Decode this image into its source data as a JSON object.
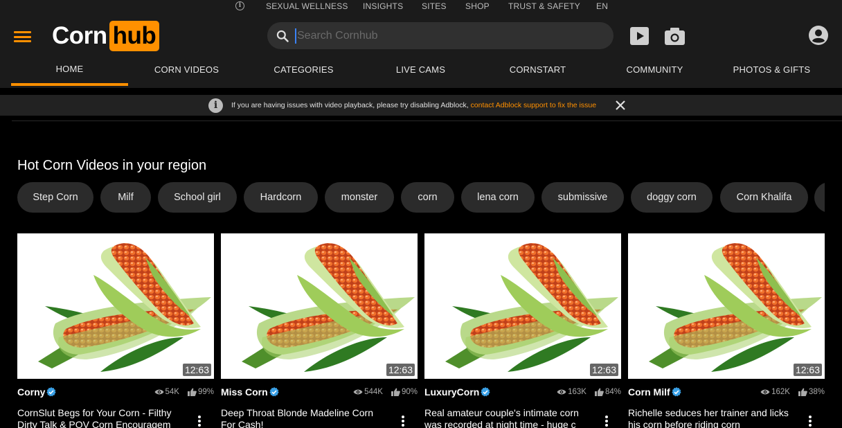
{
  "topbar": {
    "links": [
      "SEXUAL WELLNESS",
      "INSIGHTS",
      "SITES",
      "SHOP",
      "TRUST & SAFETY",
      "EN"
    ]
  },
  "header": {
    "logo_part1": "Corn",
    "logo_part2": "hub",
    "search_placeholder": "Search Cornhub",
    "search_value": "",
    "icons": [
      "menu-icon",
      "search-icon",
      "video-icon",
      "camera-icon",
      "user-icon"
    ]
  },
  "nav": {
    "tabs": [
      "HOME",
      "CORN VIDEOS",
      "CATEGORIES",
      "LIVE CAMS",
      "CORNSTART",
      "COMMUNITY",
      "PHOTOS & GIFTS"
    ],
    "active": "HOME"
  },
  "notice": {
    "text": "If you are having issues with video playback, please try disabling Adblock,",
    "link": "contact Adblock support to fix the issue"
  },
  "section": {
    "title": "Hot Corn Videos in your region"
  },
  "chips": [
    "Step Corn",
    "Milf",
    "School girl",
    "Hardcorn",
    "monster",
    "corn",
    "lena corn",
    "submissive",
    "doggy corn",
    "Corn Khalifa",
    ""
  ],
  "colors": {
    "accent": "#ff9000",
    "background": "#000000",
    "bar": "#1b1b1b",
    "chip": "#2b2b2b",
    "verified": "#3aa0e6"
  },
  "videos": [
    {
      "author": "Corny",
      "views": "54K",
      "rating": "99%",
      "duration": "12:63",
      "title_line1": "CornSlut Begs for Your Corn - Filthy",
      "title_line2": "Dirty Talk & POV Corn Encouragem"
    },
    {
      "author": "Miss Corn",
      "views": "544K",
      "rating": "90%",
      "duration": "12:63",
      "title_line1": "Deep Throat Blonde Madeline Corn",
      "title_line2": "For Cash!"
    },
    {
      "author": "LuxuryCorn",
      "views": "163K",
      "rating": "84%",
      "duration": "12:63",
      "title_line1": "Real amateur couple's intimate corn",
      "title_line2": "was recorded at night time - huge c"
    },
    {
      "author": "Corn Milf",
      "views": "162K",
      "rating": "38%",
      "duration": "12:63",
      "title_line1": "Richelle seduces her trainer and licks",
      "title_line2": "his corn before riding corn"
    }
  ]
}
